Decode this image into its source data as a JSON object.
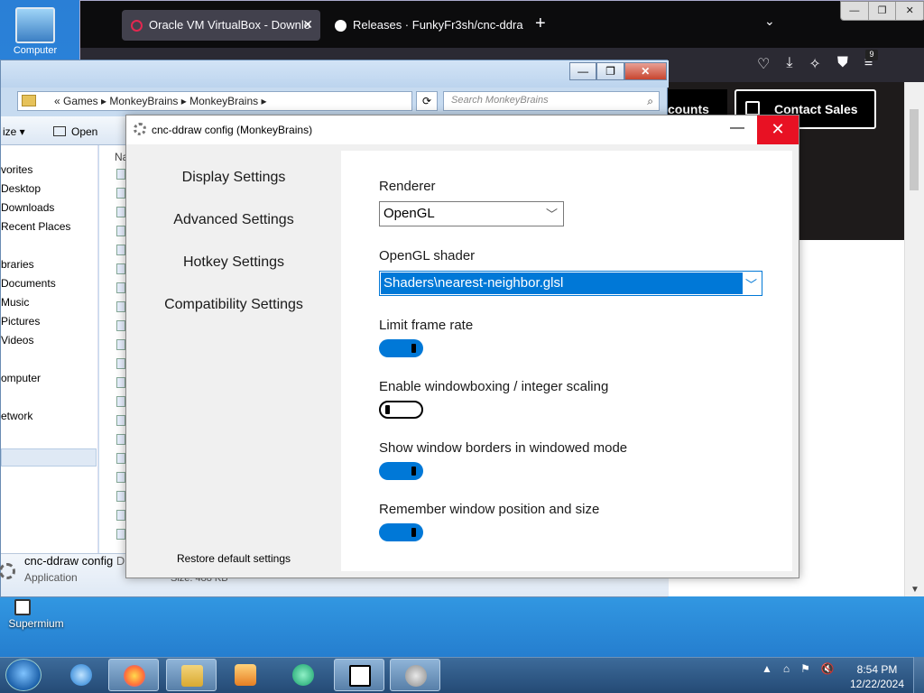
{
  "desktop": {
    "icons": [
      {
        "label": "Computer"
      },
      {
        "label": "Supermium"
      }
    ]
  },
  "browser": {
    "tabs": [
      {
        "label": "Oracle VM VirtualBox - Downlo",
        "close": "✕"
      },
      {
        "label": "Releases · FunkyFr3sh/cnc-ddra"
      }
    ],
    "new_tab": "+",
    "list_tabs": "⌄",
    "window_buttons": [
      "—",
      "❐",
      "✕"
    ],
    "badge": "9",
    "page": {
      "accounts_label": "counts",
      "contact_sales": "Contact Sales"
    }
  },
  "explorer": {
    "breadcrumb": "«  Games  ▸  MonkeyBrains  ▸  MonkeyBrains  ▸",
    "search_placeholder": "Search MonkeyBrains",
    "organize": "ize ▾",
    "open": "Open",
    "name_col": "Na",
    "nav": [
      {
        "label": "vorites"
      },
      {
        "label": "Desktop"
      },
      {
        "label": "Downloads"
      },
      {
        "label": "Recent Places"
      },
      {
        "label": "braries"
      },
      {
        "label": "Documents"
      },
      {
        "label": "Music"
      },
      {
        "label": "Pictures"
      },
      {
        "label": "Videos"
      },
      {
        "label": "omputer"
      },
      {
        "label": "etwork"
      }
    ],
    "details": {
      "name": "cnc-ddraw config",
      "name_suffix": "D",
      "type": "Application",
      "size": "Size: 488 KB"
    },
    "window_buttons": [
      "—",
      "❐",
      "✕"
    ]
  },
  "dialog": {
    "title": "cnc-ddraw config (MonkeyBrains)",
    "minimize": "—",
    "close": "✕",
    "sidebar": [
      {
        "label": "Display Settings"
      },
      {
        "label": "Advanced Settings"
      },
      {
        "label": "Hotkey Settings"
      },
      {
        "label": "Compatibility Settings"
      }
    ],
    "restore_label": "Restore default settings",
    "renderer": {
      "label": "Renderer",
      "value": "OpenGL"
    },
    "shader": {
      "label": "OpenGL shader",
      "value": "Shaders\\nearest-neighbor.glsl"
    },
    "toggles": [
      {
        "label": "Limit frame rate",
        "on": true
      },
      {
        "label": "Enable windowboxing / integer scaling",
        "on": false
      },
      {
        "label": "Show window borders in windowed mode",
        "on": true
      },
      {
        "label": "Remember window position and size",
        "on": true
      }
    ]
  },
  "taskbar": {
    "clock_time": "8:54 PM",
    "clock_date": "12/22/2024",
    "tray_expand": "▲"
  },
  "colors": {
    "accent": "#0078d7",
    "close_red": "#e81123",
    "firefox_dark": "#1c1b22"
  }
}
